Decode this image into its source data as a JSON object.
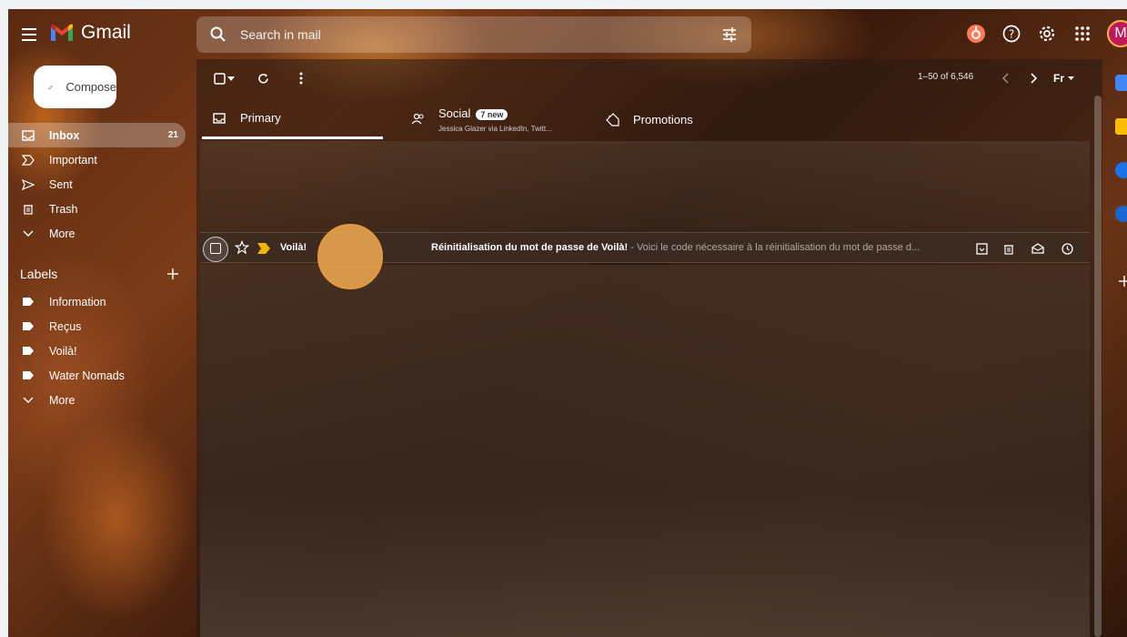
{
  "app": {
    "name": "Gmail"
  },
  "search": {
    "placeholder": "Search in mail"
  },
  "account": {
    "initial": "M"
  },
  "compose": {
    "label": "Compose"
  },
  "nav": {
    "items": [
      {
        "label": "Inbox",
        "count": "21"
      },
      {
        "label": "Important"
      },
      {
        "label": "Sent"
      },
      {
        "label": "Trash"
      },
      {
        "label": "More"
      }
    ]
  },
  "labels": {
    "heading": "Labels",
    "items": [
      {
        "label": "Information"
      },
      {
        "label": "Reçus"
      },
      {
        "label": "Voilà!"
      },
      {
        "label": "Water Nomads"
      },
      {
        "label": "More"
      }
    ]
  },
  "toolbar": {
    "page_count": "1–50 of 6,546",
    "input_tools": "Fr"
  },
  "tabs": {
    "primary": {
      "label": "Primary"
    },
    "social": {
      "label": "Social",
      "badge": "7 new",
      "subtitle": "Jessica Glazer via LinkedIn, Twitt..."
    },
    "promotions": {
      "label": "Promotions"
    }
  },
  "emails": [
    {
      "sender": "Voilà!",
      "subject": "Réinitialisation du mot de passe de Voilà!",
      "snippet": " - Voici le code nécessaire à la réinitialisation du mot de passe d..."
    }
  ],
  "colors": {
    "avatar": "#c2185b",
    "highlight": "#f0aa50",
    "important_marker": "#f5b400"
  }
}
